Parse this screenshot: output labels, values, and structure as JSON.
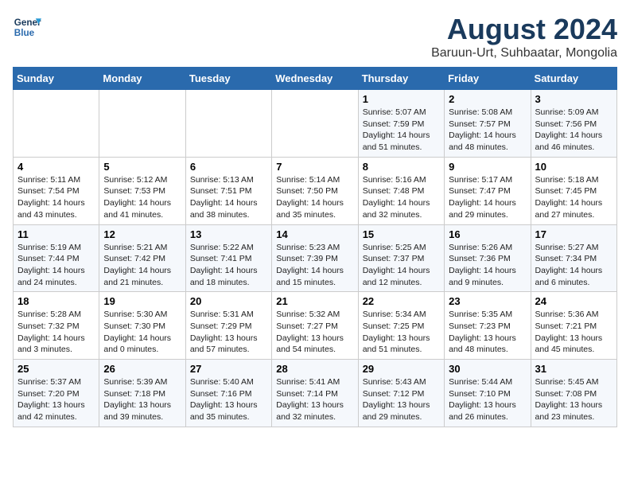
{
  "logo": {
    "line1": "General",
    "line2": "Blue"
  },
  "title": "August 2024",
  "subtitle": "Baruun-Urt, Suhbaatar, Mongolia",
  "days_of_week": [
    "Sunday",
    "Monday",
    "Tuesday",
    "Wednesday",
    "Thursday",
    "Friday",
    "Saturday"
  ],
  "weeks": [
    [
      {
        "day": "",
        "info": ""
      },
      {
        "day": "",
        "info": ""
      },
      {
        "day": "",
        "info": ""
      },
      {
        "day": "",
        "info": ""
      },
      {
        "day": "1",
        "info": "Sunrise: 5:07 AM\nSunset: 7:59 PM\nDaylight: 14 hours and 51 minutes."
      },
      {
        "day": "2",
        "info": "Sunrise: 5:08 AM\nSunset: 7:57 PM\nDaylight: 14 hours and 48 minutes."
      },
      {
        "day": "3",
        "info": "Sunrise: 5:09 AM\nSunset: 7:56 PM\nDaylight: 14 hours and 46 minutes."
      }
    ],
    [
      {
        "day": "4",
        "info": "Sunrise: 5:11 AM\nSunset: 7:54 PM\nDaylight: 14 hours and 43 minutes."
      },
      {
        "day": "5",
        "info": "Sunrise: 5:12 AM\nSunset: 7:53 PM\nDaylight: 14 hours and 41 minutes."
      },
      {
        "day": "6",
        "info": "Sunrise: 5:13 AM\nSunset: 7:51 PM\nDaylight: 14 hours and 38 minutes."
      },
      {
        "day": "7",
        "info": "Sunrise: 5:14 AM\nSunset: 7:50 PM\nDaylight: 14 hours and 35 minutes."
      },
      {
        "day": "8",
        "info": "Sunrise: 5:16 AM\nSunset: 7:48 PM\nDaylight: 14 hours and 32 minutes."
      },
      {
        "day": "9",
        "info": "Sunrise: 5:17 AM\nSunset: 7:47 PM\nDaylight: 14 hours and 29 minutes."
      },
      {
        "day": "10",
        "info": "Sunrise: 5:18 AM\nSunset: 7:45 PM\nDaylight: 14 hours and 27 minutes."
      }
    ],
    [
      {
        "day": "11",
        "info": "Sunrise: 5:19 AM\nSunset: 7:44 PM\nDaylight: 14 hours and 24 minutes."
      },
      {
        "day": "12",
        "info": "Sunrise: 5:21 AM\nSunset: 7:42 PM\nDaylight: 14 hours and 21 minutes."
      },
      {
        "day": "13",
        "info": "Sunrise: 5:22 AM\nSunset: 7:41 PM\nDaylight: 14 hours and 18 minutes."
      },
      {
        "day": "14",
        "info": "Sunrise: 5:23 AM\nSunset: 7:39 PM\nDaylight: 14 hours and 15 minutes."
      },
      {
        "day": "15",
        "info": "Sunrise: 5:25 AM\nSunset: 7:37 PM\nDaylight: 14 hours and 12 minutes."
      },
      {
        "day": "16",
        "info": "Sunrise: 5:26 AM\nSunset: 7:36 PM\nDaylight: 14 hours and 9 minutes."
      },
      {
        "day": "17",
        "info": "Sunrise: 5:27 AM\nSunset: 7:34 PM\nDaylight: 14 hours and 6 minutes."
      }
    ],
    [
      {
        "day": "18",
        "info": "Sunrise: 5:28 AM\nSunset: 7:32 PM\nDaylight: 14 hours and 3 minutes."
      },
      {
        "day": "19",
        "info": "Sunrise: 5:30 AM\nSunset: 7:30 PM\nDaylight: 14 hours and 0 minutes."
      },
      {
        "day": "20",
        "info": "Sunrise: 5:31 AM\nSunset: 7:29 PM\nDaylight: 13 hours and 57 minutes."
      },
      {
        "day": "21",
        "info": "Sunrise: 5:32 AM\nSunset: 7:27 PM\nDaylight: 13 hours and 54 minutes."
      },
      {
        "day": "22",
        "info": "Sunrise: 5:34 AM\nSunset: 7:25 PM\nDaylight: 13 hours and 51 minutes."
      },
      {
        "day": "23",
        "info": "Sunrise: 5:35 AM\nSunset: 7:23 PM\nDaylight: 13 hours and 48 minutes."
      },
      {
        "day": "24",
        "info": "Sunrise: 5:36 AM\nSunset: 7:21 PM\nDaylight: 13 hours and 45 minutes."
      }
    ],
    [
      {
        "day": "25",
        "info": "Sunrise: 5:37 AM\nSunset: 7:20 PM\nDaylight: 13 hours and 42 minutes."
      },
      {
        "day": "26",
        "info": "Sunrise: 5:39 AM\nSunset: 7:18 PM\nDaylight: 13 hours and 39 minutes."
      },
      {
        "day": "27",
        "info": "Sunrise: 5:40 AM\nSunset: 7:16 PM\nDaylight: 13 hours and 35 minutes."
      },
      {
        "day": "28",
        "info": "Sunrise: 5:41 AM\nSunset: 7:14 PM\nDaylight: 13 hours and 32 minutes."
      },
      {
        "day": "29",
        "info": "Sunrise: 5:43 AM\nSunset: 7:12 PM\nDaylight: 13 hours and 29 minutes."
      },
      {
        "day": "30",
        "info": "Sunrise: 5:44 AM\nSunset: 7:10 PM\nDaylight: 13 hours and 26 minutes."
      },
      {
        "day": "31",
        "info": "Sunrise: 5:45 AM\nSunset: 7:08 PM\nDaylight: 13 hours and 23 minutes."
      }
    ]
  ]
}
